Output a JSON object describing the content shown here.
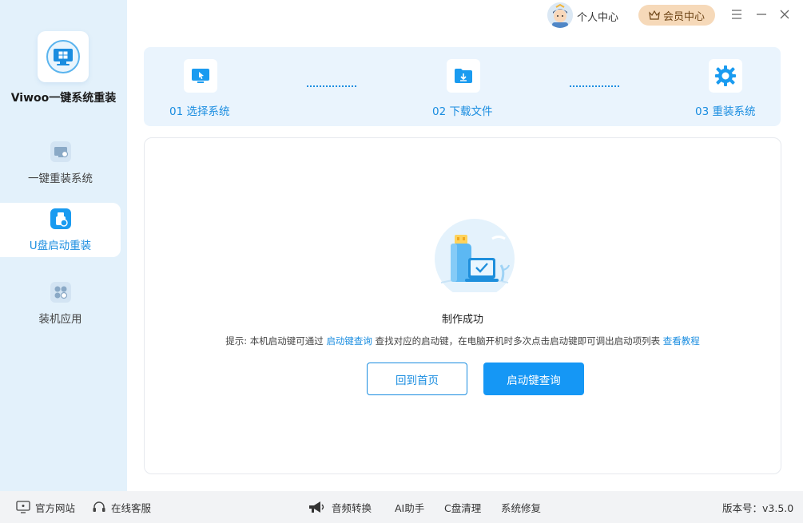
{
  "app": {
    "title": "Viwoo一键系统重装"
  },
  "sidebar": {
    "items": [
      {
        "label": "一键重装系统",
        "icon": "monitor-reinstall-icon",
        "active": false
      },
      {
        "label": "U盘启动重装",
        "icon": "usb-drive-icon",
        "active": true
      },
      {
        "label": "装机应用",
        "icon": "apps-icon",
        "active": false
      }
    ]
  },
  "topbar": {
    "personal_label": "个人中心",
    "vip_label": "会员中心"
  },
  "steps": [
    {
      "label": "01 选择系统",
      "icon": "monitor-cursor-icon"
    },
    {
      "label": "02 下载文件",
      "icon": "folder-download-icon"
    },
    {
      "label": "03 重装系统",
      "icon": "gear-icon"
    }
  ],
  "main": {
    "status": "制作成功",
    "tip": {
      "prefix": "提示: 本机启动键可通过 ",
      "link1": "启动键查询",
      "middle": " 查找对应的启动键，在电脑开机时多次点击启动键即可调出启动项列表 ",
      "link2": "查看教程"
    },
    "home_button": "回到首页",
    "query_button": "启动键查询"
  },
  "footer": {
    "website": "官方网站",
    "support": "在线客服",
    "audio": "音频转换",
    "ai": "AI助手",
    "cclean": "C盘清理",
    "repair": "系统修复",
    "version": "版本号：v3.5.0"
  },
  "colors": {
    "accent": "#1a8de0",
    "primary_button": "#1597f5",
    "sidebar_bg": "#e3f1fb",
    "vip_bg": "#f6d9b9"
  }
}
